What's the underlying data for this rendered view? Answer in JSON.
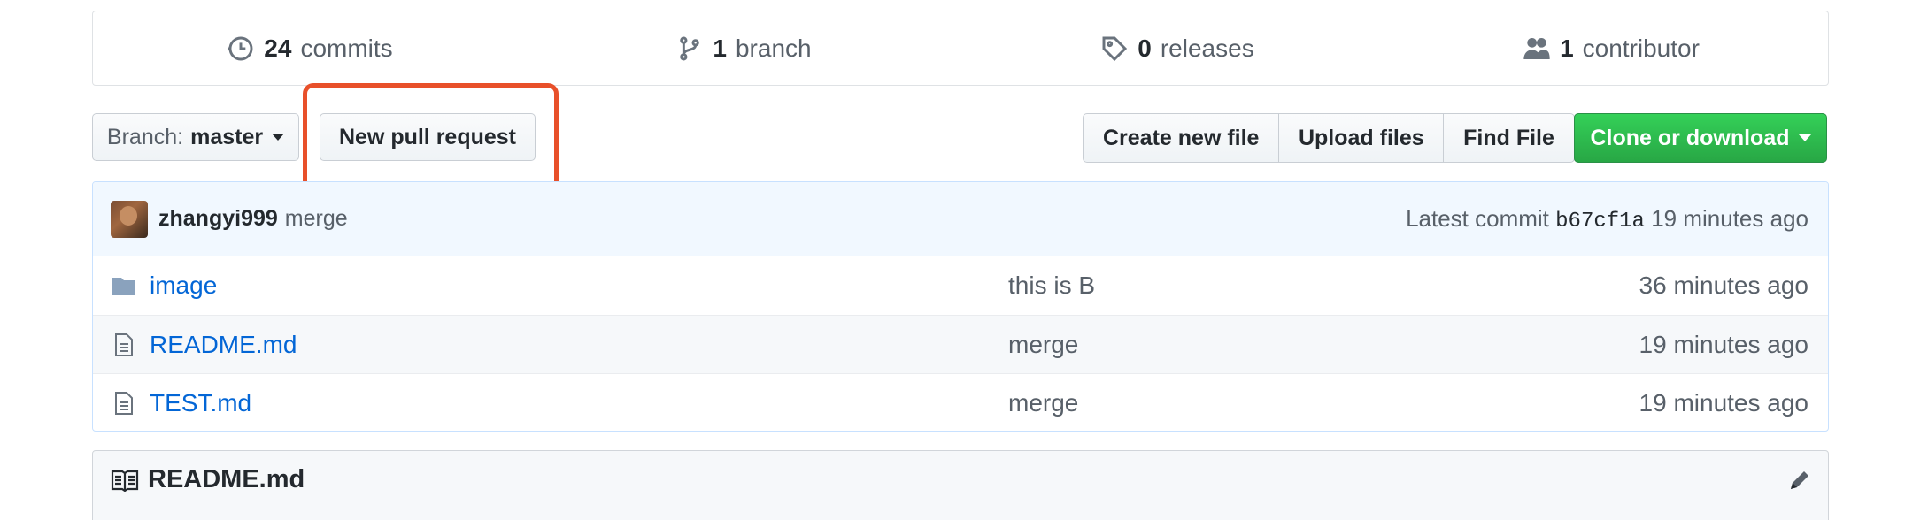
{
  "stats": {
    "commits": {
      "count": "24",
      "label": "commits",
      "icon": "history-icon"
    },
    "branches": {
      "count": "1",
      "label": "branch",
      "icon": "git-branch-icon"
    },
    "releases": {
      "count": "0",
      "label": "releases",
      "icon": "tag-icon"
    },
    "contributors": {
      "count": "1",
      "label": "contributor",
      "icon": "people-icon"
    }
  },
  "toolbar": {
    "branch_prefix": "Branch:",
    "branch_name": "master",
    "new_pull_request": "New pull request",
    "create_new_file": "Create new file",
    "upload_files": "Upload files",
    "find_file": "Find File",
    "clone_or_download": "Clone or download"
  },
  "latest_commit": {
    "author": "zhangyi999",
    "message": "merge",
    "prefix": "Latest commit",
    "sha": "b67cf1a",
    "age": "19 minutes ago"
  },
  "files": [
    {
      "name": "image",
      "type": "folder",
      "message": "this is B",
      "age": "36 minutes ago"
    },
    {
      "name": "README.md",
      "type": "file",
      "message": "merge",
      "age": "19 minutes ago"
    },
    {
      "name": "TEST.md",
      "type": "file",
      "message": "merge",
      "age": "19 minutes ago"
    }
  ],
  "readme": {
    "title": "README.md"
  },
  "colors": {
    "link": "#0366d6",
    "highlight": "#e8502a",
    "clone_green": "#28a745",
    "commit_bar_bg": "#f1f8ff"
  }
}
